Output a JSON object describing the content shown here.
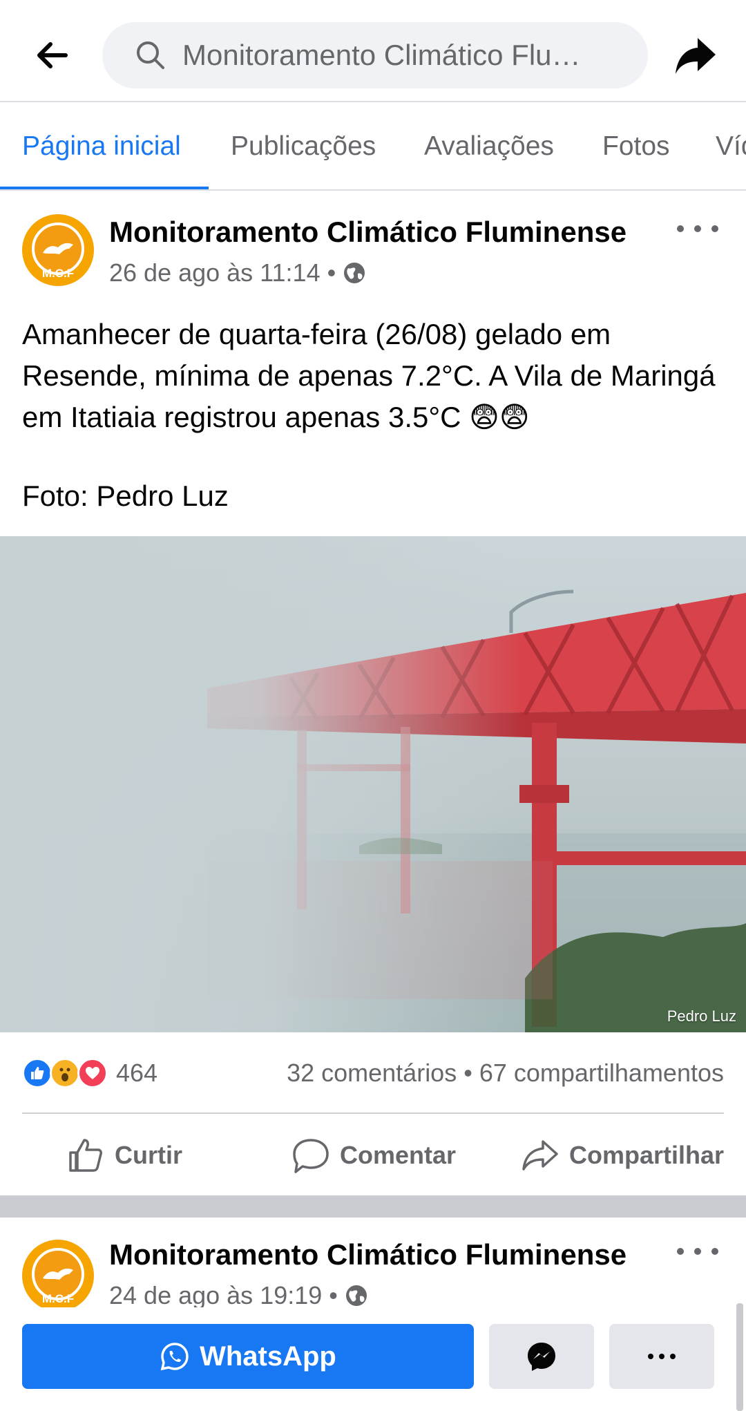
{
  "search": {
    "text": "Monitoramento Climático Flu…"
  },
  "tabs": [
    {
      "label": "Página inicial"
    },
    {
      "label": "Publicações"
    },
    {
      "label": "Avaliações"
    },
    {
      "label": "Fotos"
    },
    {
      "label": "Víd"
    }
  ],
  "post": {
    "page_name": "Monitoramento Climático Fluminense",
    "timestamp": "26 de ago às 11:14",
    "separator": "•",
    "avatar_text": "M.C.F",
    "text_line1": "Amanhecer de quarta-feira (26/08) gelado em Resende, mínima de apenas 7.2°C. A Vila de Maringá em Itatiaia registrou apenas 3.5°C 😨😨",
    "credit": "Foto: Pedro Luz",
    "photo_watermark": "Pedro Luz",
    "reaction_count": "464",
    "comments_shares": "32 comentários • 67 compartilhamentos",
    "actions": {
      "like": "Curtir",
      "comment": "Comentar",
      "share": "Compartilhar"
    }
  },
  "post2": {
    "page_name": "Monitoramento Climático Fluminense",
    "timestamp": "24 de ago às 19:19",
    "separator": "•",
    "avatar_text": "M.C.F"
  },
  "bottom_bar": {
    "whatsapp_label": "WhatsApp"
  },
  "colors": {
    "accent": "#1877f2",
    "bridge": "#d8424a",
    "avatar": "#f5a400"
  }
}
